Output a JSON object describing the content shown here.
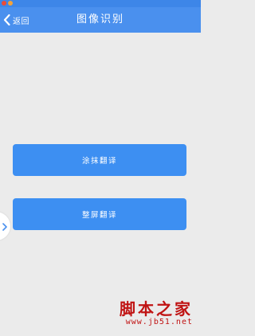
{
  "header": {
    "back_label": "返回",
    "title": "图像识别"
  },
  "main": {
    "buttons": [
      {
        "label": "涂抹翻译"
      },
      {
        "label": "整屏翻译"
      }
    ]
  },
  "watermark": {
    "title": "脚本之家",
    "url": "www.jb51.net"
  },
  "colors": {
    "header": "#4a90ee",
    "button": "#3d8ff2",
    "background": "#ebebeb",
    "watermark": "#c01313"
  },
  "icons": {
    "back": "chevron-left-icon",
    "side_handle": "chevron-right-icon"
  }
}
